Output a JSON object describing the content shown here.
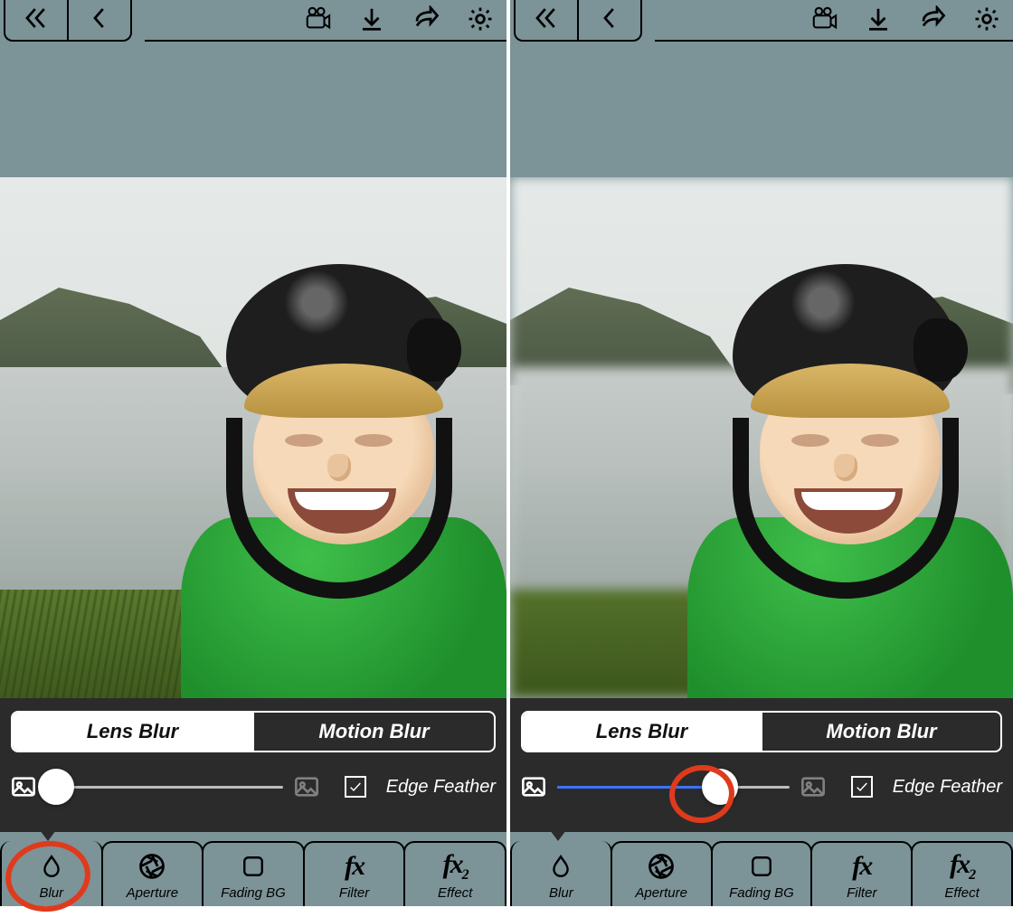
{
  "panes": [
    {
      "id": "left",
      "segmented": {
        "options": [
          "Lens Blur",
          "Motion Blur"
        ],
        "active": 0
      },
      "slider": {
        "value_pct": 4
      },
      "edge_feather": {
        "label": "Edge Feather",
        "checked": true
      },
      "blurred_preview": false,
      "annotation_target": "blur-tab"
    },
    {
      "id": "right",
      "segmented": {
        "options": [
          "Lens Blur",
          "Motion Blur"
        ],
        "active": 0
      },
      "slider": {
        "value_pct": 70
      },
      "edge_feather": {
        "label": "Edge Feather",
        "checked": true
      },
      "blurred_preview": true,
      "annotation_target": "slider-thumb"
    }
  ],
  "tabs": [
    {
      "key": "blur",
      "label": "Blur"
    },
    {
      "key": "aperture",
      "label": "Aperture"
    },
    {
      "key": "fadingbg",
      "label": "Fading BG"
    },
    {
      "key": "filter",
      "label": "Filter"
    },
    {
      "key": "effect",
      "label": "Effect"
    }
  ],
  "active_tab": "blur"
}
